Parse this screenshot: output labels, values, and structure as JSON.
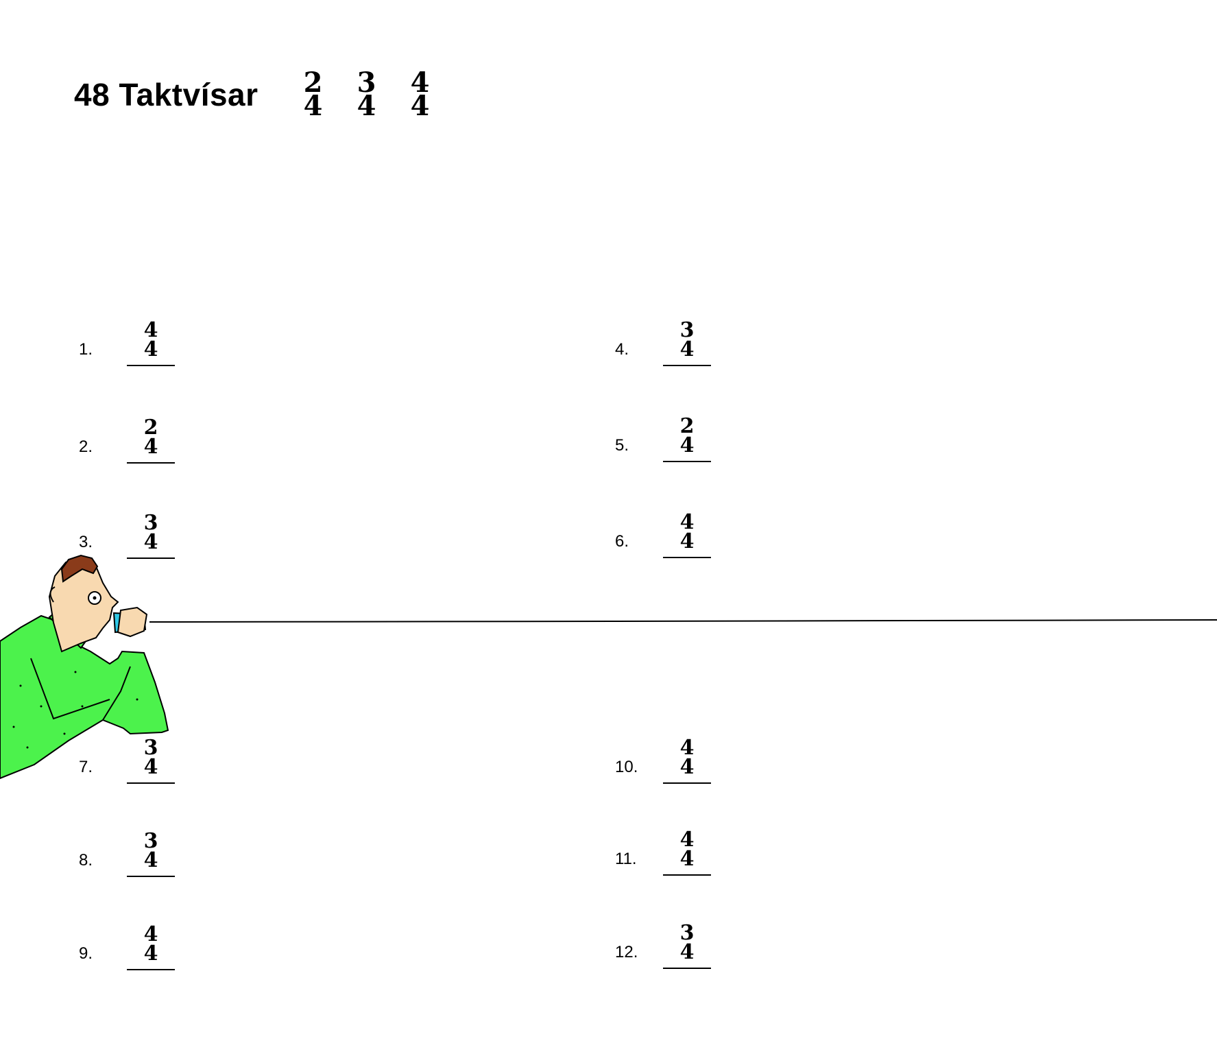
{
  "title": {
    "text": "48 Taktvísar",
    "signatures": [
      {
        "top": "2",
        "bottom": "4"
      },
      {
        "top": "3",
        "bottom": "4"
      },
      {
        "top": "4",
        "bottom": "4"
      }
    ]
  },
  "exercises": [
    {
      "number": "1.",
      "top": "4",
      "bottom": "4"
    },
    {
      "number": "2.",
      "top": "2",
      "bottom": "4"
    },
    {
      "number": "3.",
      "top": "3",
      "bottom": "4"
    },
    {
      "number": "4.",
      "top": "3",
      "bottom": "4"
    },
    {
      "number": "5.",
      "top": "2",
      "bottom": "4"
    },
    {
      "number": "6.",
      "top": "4",
      "bottom": "4"
    },
    {
      "number": "7.",
      "top": "3",
      "bottom": "4"
    },
    {
      "number": "8.",
      "top": "3",
      "bottom": "4"
    },
    {
      "number": "9.",
      "top": "4",
      "bottom": "4"
    },
    {
      "number": "10.",
      "top": "4",
      "bottom": "4"
    },
    {
      "number": "11.",
      "top": "4",
      "bottom": "4"
    },
    {
      "number": "12.",
      "top": "3",
      "bottom": "4"
    }
  ],
  "illustration": {
    "sweater_color": "#4cf24c",
    "skin_color": "#f8d9b0",
    "hair_color": "#8a3b1a",
    "can_color": "#2fc8e6"
  }
}
